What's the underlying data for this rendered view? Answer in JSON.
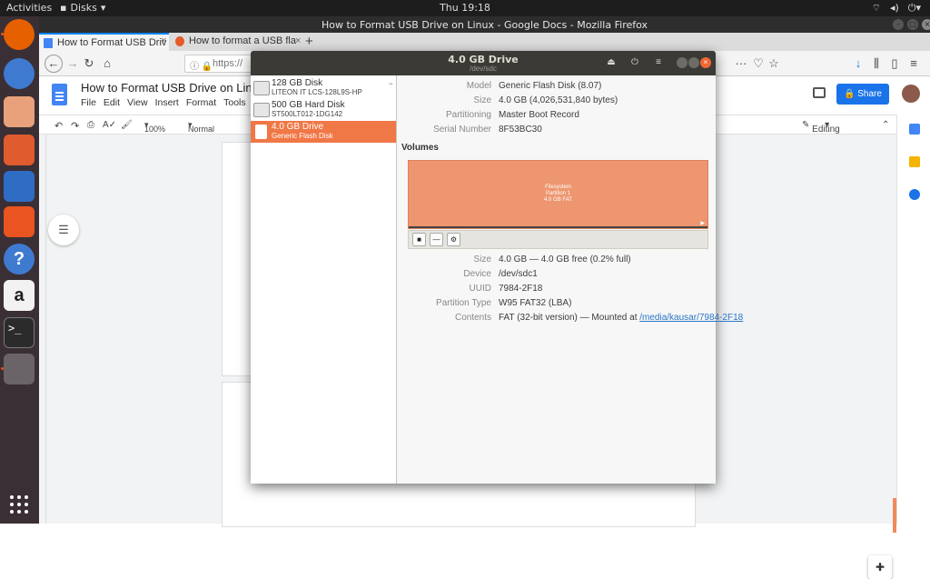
{
  "topbar": {
    "activities": "Activities",
    "app_menu": "Disks",
    "clock": "Thu 19:18"
  },
  "firefox": {
    "window_title": "How to Format USB Drive on Linux - Google Docs - Mozilla Firefox",
    "tabs": [
      {
        "label": "How to Format USB Driv"
      },
      {
        "label": "How to format a USB fla"
      }
    ],
    "url_partial": "https://"
  },
  "docs": {
    "title": "How to Format USB Drive on Linux",
    "menu": [
      "File",
      "Edit",
      "View",
      "Insert",
      "Format",
      "Tools",
      "Ad"
    ],
    "zoom": "100%",
    "style": "Normal text",
    "mode": "Editing",
    "share_label": "Share"
  },
  "disks": {
    "title": "4.0 GB Drive",
    "subtitle": "/dev/sdc",
    "drives": [
      {
        "name": "128 GB Disk",
        "model": "LITEON IT LCS-128L9S-HP"
      },
      {
        "name": "500 GB Hard Disk",
        "model": "ST500LT012-1DG142"
      },
      {
        "name": "4.0 GB Drive",
        "model": "Generic Flash Disk"
      }
    ],
    "drive_info": [
      {
        "key": "Model",
        "value": "Generic Flash Disk (8.07)"
      },
      {
        "key": "Size",
        "value": "4.0 GB (4,026,531,840 bytes)"
      },
      {
        "key": "Partitioning",
        "value": "Master Boot Record"
      },
      {
        "key": "Serial Number",
        "value": "8F53BC30"
      }
    ],
    "volumes_label": "Volumes",
    "volume_block": {
      "line1": "Filesystem",
      "line2": "Partition 1",
      "line3": "4.0 GB FAT"
    },
    "volume_info": [
      {
        "key": "Size",
        "value": "4.0 GB — 4.0 GB free (0.2% full)"
      },
      {
        "key": "Device",
        "value": "/dev/sdc1"
      },
      {
        "key": "UUID",
        "value": "7984-2F18"
      },
      {
        "key": "Partition Type",
        "value": "W95 FAT32 (LBA)"
      },
      {
        "key": "Contents",
        "value": "FAT (32-bit version) — Mounted at",
        "link": "/media/kausar/7984-2F18"
      }
    ]
  }
}
